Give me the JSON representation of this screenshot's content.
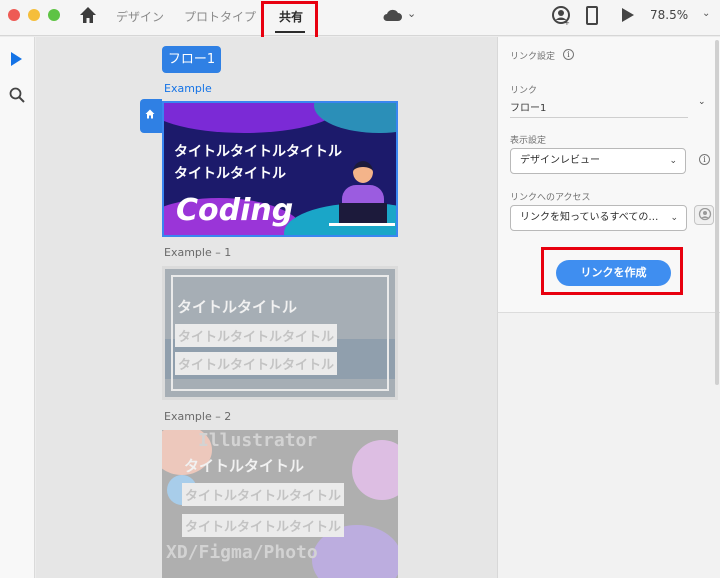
{
  "topbar": {
    "tabs": [
      {
        "label": "デザイン"
      },
      {
        "label": "プロトタイプ"
      },
      {
        "label": "共有"
      }
    ],
    "zoom": "78.5%"
  },
  "canvas": {
    "flow_button": "フロー1",
    "artboards": [
      {
        "title": "Example",
        "heading_lines": [
          "タイトルタイトルタイトル",
          "タイトルタイトル"
        ],
        "big_text": "Coding"
      },
      {
        "title": "Example – 1",
        "heading": "タイトルタイトル",
        "boxes": [
          "タイトルタイトルタイトル",
          "タイトルタイトルタイトル"
        ]
      },
      {
        "title": "Example – 2",
        "watermark_top": "Illustrator",
        "heading": "タイトルタイトル",
        "boxes": [
          "タイトルタイトルタイトル",
          "タイトルタイトルタイトル"
        ],
        "watermark_bottom": "XD/Figma/Photo"
      }
    ]
  },
  "panel": {
    "link_settings_label": "リンク設定",
    "link_label": "リンク",
    "link_value": "フロー1",
    "display_settings_label": "表示設定",
    "display_value": "デザインレビュー",
    "access_label": "リンクへのアクセス",
    "access_value": "リンクを知っているすべての…",
    "create_button": "リンクを作成"
  },
  "colors": {
    "accent": "#2f80e4",
    "highlight": "#e8000f"
  }
}
